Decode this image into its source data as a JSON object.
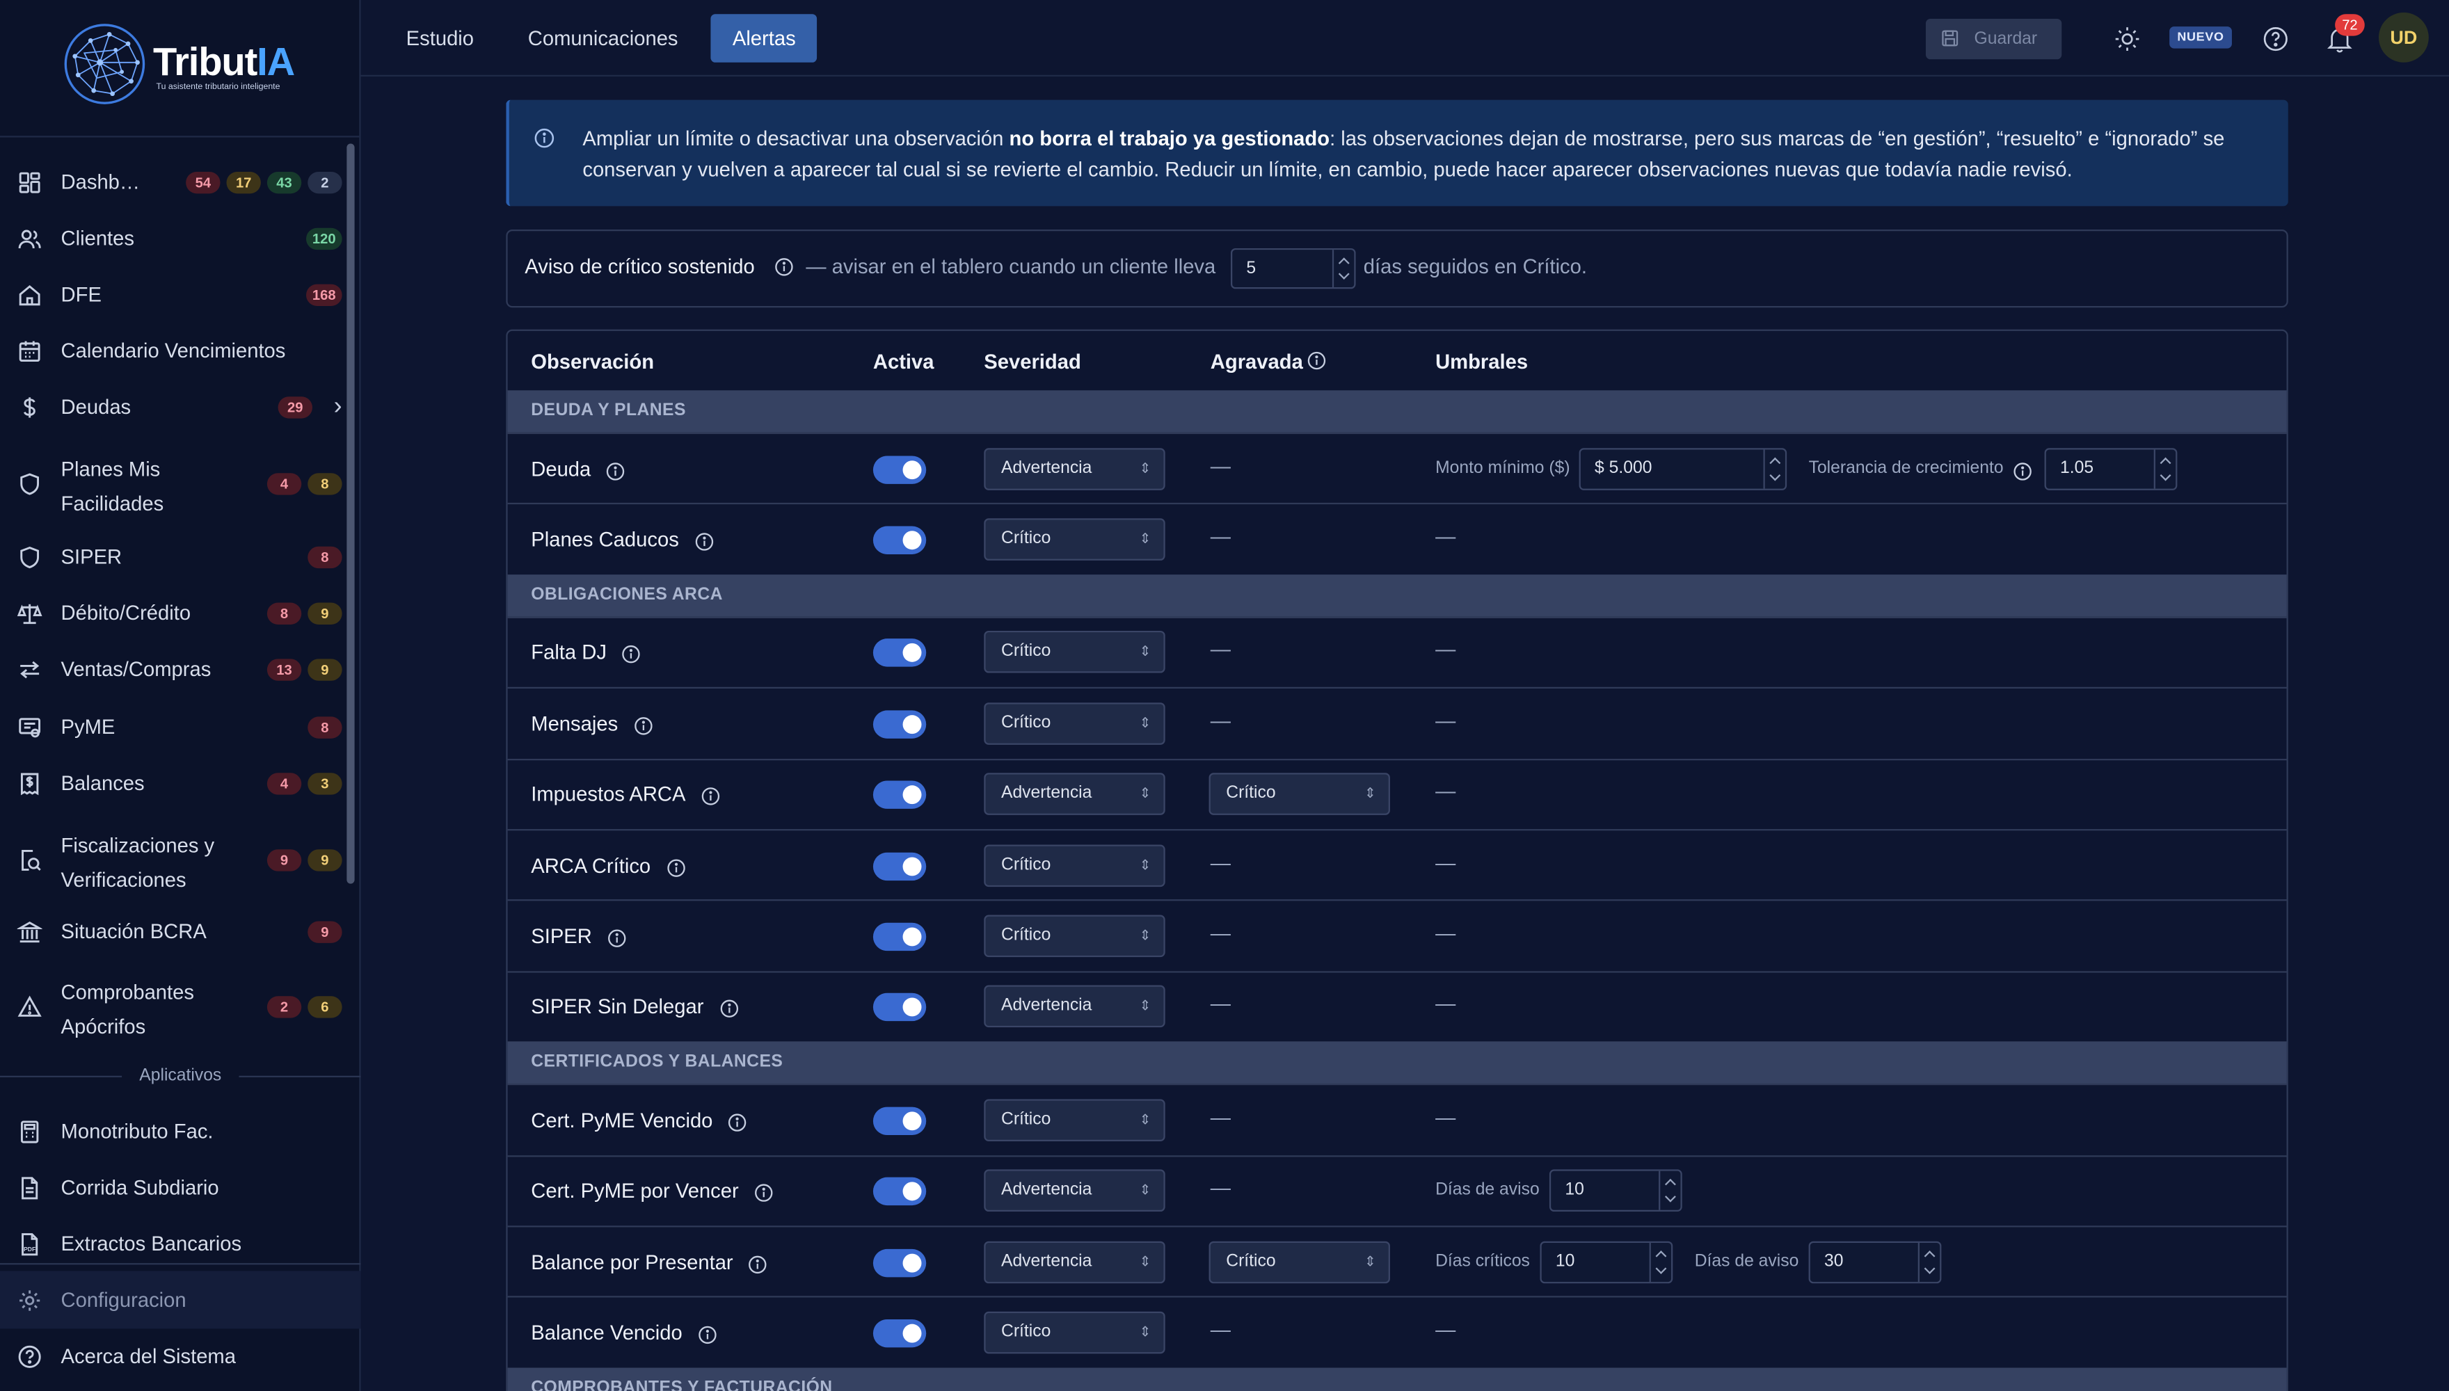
{
  "app": {
    "name_main": "Tribut",
    "name_accent": "IA",
    "tagline": "Tu asistente tributario inteligente"
  },
  "sidebar": {
    "items": [
      {
        "label": "Dashb…",
        "icon": "dashboard-icon",
        "badges": [
          {
            "v": "54",
            "c": "r"
          },
          {
            "v": "17",
            "c": "y"
          },
          {
            "v": "43",
            "c": "g"
          },
          {
            "v": "2",
            "c": "b"
          }
        ]
      },
      {
        "label": "Clientes",
        "icon": "users-icon",
        "badges": [
          {
            "v": "120",
            "c": "g"
          }
        ]
      },
      {
        "label": "DFE",
        "icon": "home-icon",
        "badges": [
          {
            "v": "168",
            "c": "r"
          }
        ]
      },
      {
        "label": "Calendario Vencimientos",
        "icon": "calendar-icon",
        "badges": []
      },
      {
        "label": "Deudas",
        "icon": "dollar-icon",
        "badges": [
          {
            "v": "29",
            "c": "r"
          }
        ],
        "chevron": "›"
      },
      {
        "label": "Planes Mis Facilidades",
        "icon": "shield-icon",
        "badges": [
          {
            "v": "4",
            "c": "r"
          },
          {
            "v": "8",
            "c": "y"
          }
        ]
      },
      {
        "label": "SIPER",
        "icon": "shield-icon",
        "badges": [
          {
            "v": "8",
            "c": "r"
          }
        ]
      },
      {
        "label": "Débito/Crédito",
        "icon": "scale-icon",
        "badges": [
          {
            "v": "8",
            "c": "r"
          },
          {
            "v": "9",
            "c": "y"
          }
        ]
      },
      {
        "label": "Ventas/Compras",
        "icon": "arrows-icon",
        "badges": [
          {
            "v": "13",
            "c": "r"
          },
          {
            "v": "9",
            "c": "y"
          }
        ]
      },
      {
        "label": "PyME",
        "icon": "pyme-icon",
        "badges": [
          {
            "v": "8",
            "c": "r"
          }
        ]
      },
      {
        "label": "Balances",
        "icon": "receipt-icon",
        "badges": [
          {
            "v": "4",
            "c": "r"
          },
          {
            "v": "3",
            "c": "y"
          }
        ]
      },
      {
        "label": "Fiscalizaciones y Verificaciones",
        "icon": "search-doc-icon",
        "badges": [
          {
            "v": "9",
            "c": "r"
          },
          {
            "v": "9",
            "c": "y"
          }
        ]
      },
      {
        "label": "Situación BCRA",
        "icon": "bank-icon",
        "badges": [
          {
            "v": "9",
            "c": "r"
          }
        ]
      },
      {
        "label": "Comprobantes Apócrifos",
        "icon": "warning-icon",
        "badges": [
          {
            "v": "2",
            "c": "r"
          },
          {
            "v": "6",
            "c": "y"
          }
        ]
      }
    ],
    "apps_label": "Aplicativos",
    "apps": [
      {
        "label": "Monotributo Fac.",
        "icon": "calculator-icon"
      },
      {
        "label": "Corrida Subdiario",
        "icon": "document-icon"
      },
      {
        "label": "Extractos Bancarios",
        "icon": "pdf-icon"
      }
    ],
    "config_label": "Configuracion",
    "about_label": "Acerca del Sistema"
  },
  "topbar": {
    "tabs": [
      "Estudio",
      "Comunicaciones",
      "Alertas"
    ],
    "active_tab": "Alertas",
    "save_label": "Guardar",
    "nuevo_label": "NUEVO",
    "notif_count": "72",
    "avatar": "UD"
  },
  "info": {
    "pre": "Ampliar un límite o desactivar una observación ",
    "bold": "no borra el trabajo ya gestionado",
    "post": ": las observaciones dejan de mostrarse, pero sus marcas de “en gestión”, “resuelto” e “ignorado” se conservan y vuelven a aparecer tal cual si se revierte el cambio. Reducir un límite, en cambio, puede hacer aparecer observaciones nuevas que todavía nadie revisó."
  },
  "critical_notice": {
    "label": "Aviso de crítico sostenido",
    "pre": "— avisar en el tablero cuando un cliente lleva",
    "value": "5",
    "post": "días seguidos en Crítico."
  },
  "table": {
    "headers": {
      "obs": "Observación",
      "active": "Activa",
      "severity": "Severidad",
      "aggravated": "Agravada",
      "thresholds": "Umbrales"
    },
    "dash": "—",
    "groups": [
      {
        "title": "DEUDA Y PLANES",
        "rows": [
          {
            "name": "Deuda",
            "active": true,
            "severity": "Advertencia",
            "aggravated": null,
            "thresholds": [
              {
                "label": "Monto mínimo ($)",
                "value": "$ 5.000",
                "w": 133
              },
              {
                "label": "Tolerancia de crecimiento",
                "value": "1.05",
                "w": 85,
                "info": true
              }
            ]
          },
          {
            "name": "Planes Caducos",
            "active": true,
            "severity": "Crítico",
            "aggravated": null,
            "thresholds": []
          }
        ]
      },
      {
        "title": "OBLIGACIONES ARCA",
        "rows": [
          {
            "name": "Falta DJ",
            "active": true,
            "severity": "Crítico",
            "aggravated": null,
            "thresholds": []
          },
          {
            "name": "Mensajes",
            "active": true,
            "severity": "Crítico",
            "aggravated": null,
            "thresholds": []
          },
          {
            "name": "Impuestos ARCA",
            "active": true,
            "severity": "Advertencia",
            "aggravated": "Crítico",
            "thresholds": []
          },
          {
            "name": "ARCA Crítico",
            "active": true,
            "severity": "Crítico",
            "aggravated": null,
            "thresholds": []
          },
          {
            "name": "SIPER",
            "active": true,
            "severity": "Crítico",
            "aggravated": null,
            "thresholds": []
          },
          {
            "name": "SIPER Sin Delegar",
            "active": true,
            "severity": "Advertencia",
            "aggravated": null,
            "thresholds": []
          }
        ]
      },
      {
        "title": "CERTIFICADOS Y BALANCES",
        "rows": [
          {
            "name": "Cert. PyME Vencido",
            "active": true,
            "severity": "Crítico",
            "aggravated": null,
            "thresholds": []
          },
          {
            "name": "Cert. PyME por Vencer",
            "active": true,
            "severity": "Advertencia",
            "aggravated": null,
            "thresholds": [
              {
                "label": "Días de aviso",
                "value": "10",
                "w": 85
              }
            ]
          },
          {
            "name": "Balance por Presentar",
            "active": true,
            "severity": "Advertencia",
            "aggravated": "Crítico",
            "thresholds": [
              {
                "label": "Días críticos",
                "value": "10",
                "w": 85
              },
              {
                "label": "Días de aviso",
                "value": "30",
                "w": 85
              }
            ]
          },
          {
            "name": "Balance Vencido",
            "active": true,
            "severity": "Crítico",
            "aggravated": null,
            "thresholds": []
          }
        ]
      },
      {
        "title": "COMPROBANTES Y FACTURACIÓN",
        "rows": []
      }
    ]
  },
  "colors": {
    "accent": "#3460a8",
    "toggle_on": "#3a6ad1",
    "badge_red": "#f59aa8",
    "badge_yellow": "#f2cf78",
    "badge_green": "#7ad7a6"
  }
}
